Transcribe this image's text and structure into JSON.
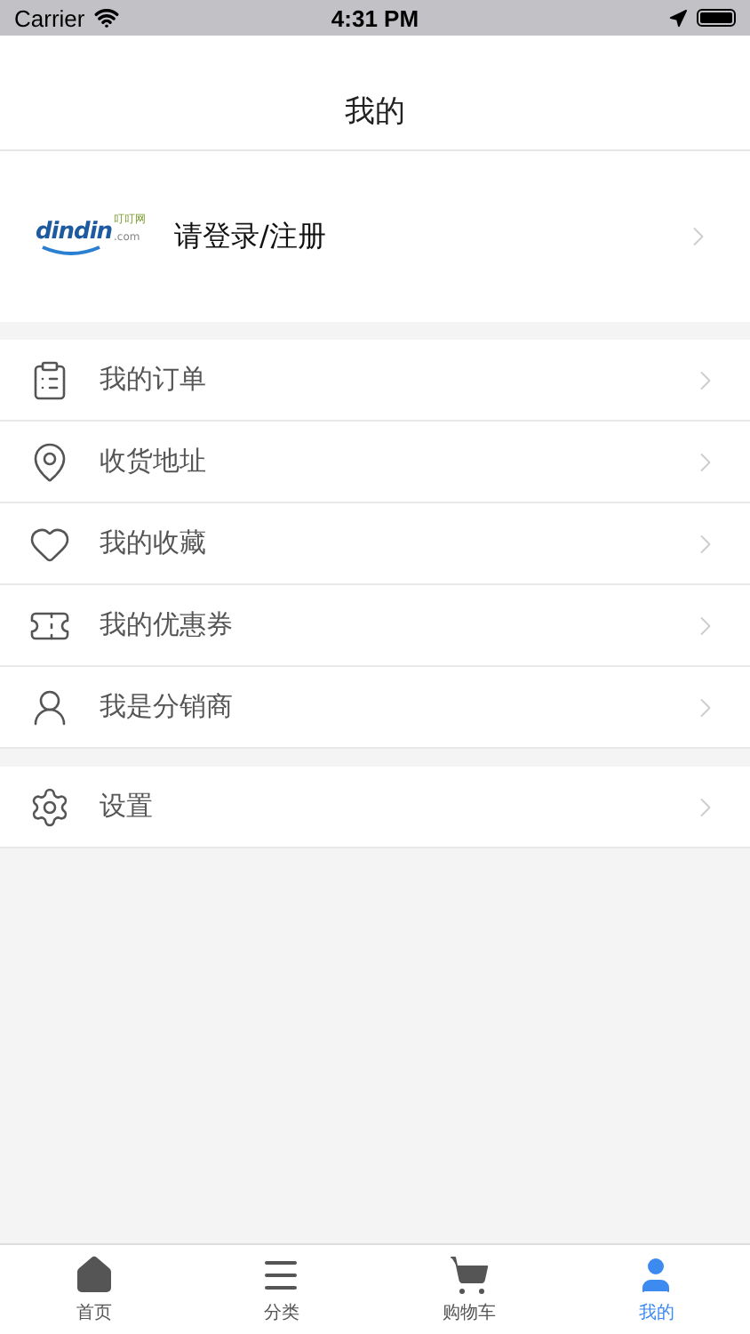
{
  "status_bar": {
    "carrier": "Carrier",
    "time": "4:31 PM"
  },
  "nav_bar": {
    "title": "我的"
  },
  "login": {
    "logo": {
      "brand": "dindin",
      "tag": "叮叮网",
      "domain": ".com"
    },
    "label": "请登录/注册"
  },
  "menu_groups": [
    [
      {
        "kind": "orders",
        "label": "我的订单"
      },
      {
        "kind": "address",
        "label": "收货地址"
      },
      {
        "kind": "favorites",
        "label": "我的收藏"
      },
      {
        "kind": "coupons",
        "label": "我的优惠券"
      },
      {
        "kind": "distributor",
        "label": "我是分销商"
      }
    ],
    [
      {
        "kind": "settings",
        "label": "设置"
      }
    ]
  ],
  "tab_bar": [
    {
      "kind": "home",
      "label": "首页",
      "selected": false
    },
    {
      "kind": "category",
      "label": "分类",
      "selected": false
    },
    {
      "kind": "cart",
      "label": "购物车",
      "selected": false
    },
    {
      "kind": "me",
      "label": "我的",
      "selected": true
    }
  ]
}
